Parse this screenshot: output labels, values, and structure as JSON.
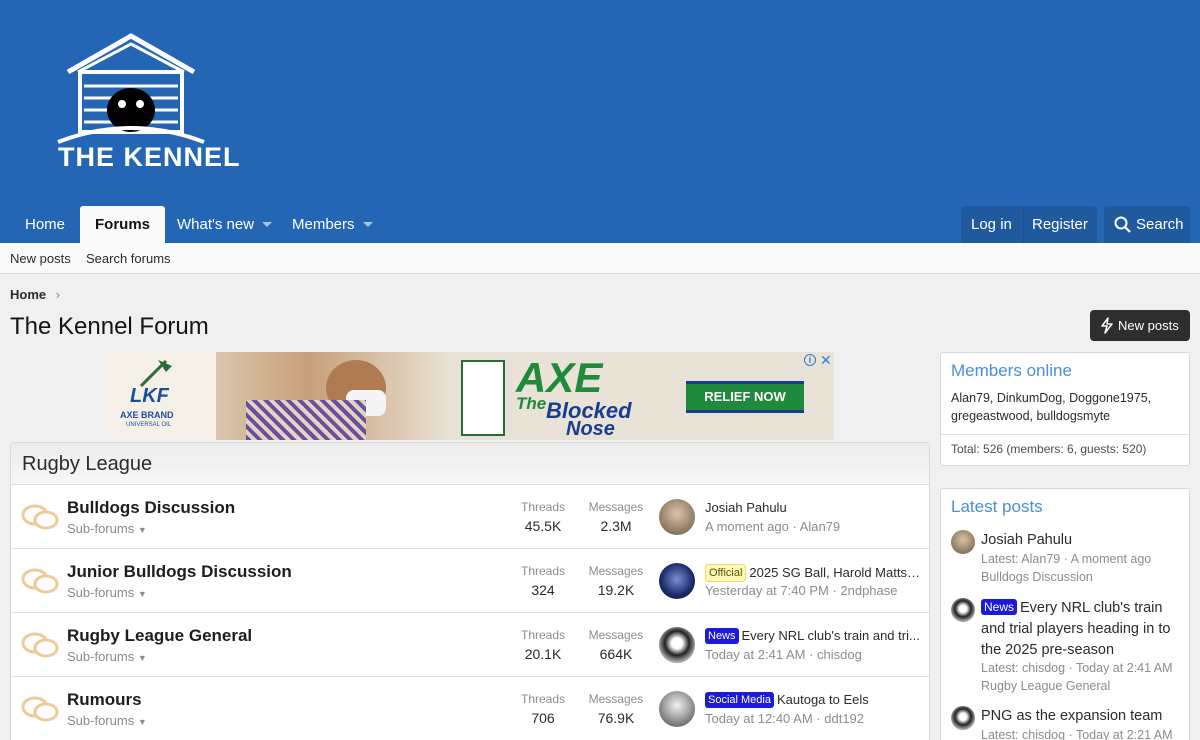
{
  "brand": {
    "name": "THE KENNEL"
  },
  "nav": {
    "tabs": [
      {
        "label": "Home"
      },
      {
        "label": "Forums"
      },
      {
        "label": "What's new"
      },
      {
        "label": "Members"
      }
    ],
    "login_label": "Log in",
    "register_label": "Register",
    "search_label": "Search"
  },
  "subnav": {
    "new_posts": "New posts",
    "search_forums": "Search forums"
  },
  "breadcrumb": {
    "home": "Home"
  },
  "page": {
    "title": "The Kennel Forum",
    "new_posts_button": "New posts"
  },
  "ad": {
    "brand_letters": "LKF",
    "brand_line1": "AXE BRAND",
    "brand_line2": "UNIVERSAL OIL",
    "headline_axe": "AXE",
    "headline_the": "The",
    "headline_blocked": "Blocked",
    "headline_nose": "Nose",
    "cta": "RELIEF NOW"
  },
  "category": {
    "title": "Rugby League",
    "threads_label": "Threads",
    "messages_label": "Messages",
    "subforums_label": "Sub-forums",
    "nodes": [
      {
        "title": "Bulldogs Discussion",
        "threads": "45.5K",
        "messages": "2.3M",
        "last_prefix": "",
        "last_title": "Josiah Pahulu",
        "last_time": "A moment ago",
        "last_user": "Alan79"
      },
      {
        "title": "Junior Bulldogs Discussion",
        "threads": "324",
        "messages": "19.2K",
        "last_prefix": "Official",
        "last_title": "2025 SG Ball, Harold Matts ...",
        "last_time": "Yesterday at 7:40 PM",
        "last_user": "2ndphase"
      },
      {
        "title": "Rugby League General",
        "threads": "20.1K",
        "messages": "664K",
        "last_prefix": "News",
        "last_title": "Every NRL club's train and tri...",
        "last_time": "Today at 2:41 AM",
        "last_user": "chisdog"
      },
      {
        "title": "Rumours",
        "threads": "706",
        "messages": "76.9K",
        "last_prefix": "Social Media",
        "last_title": "Kautoga to Eels",
        "last_time": "Today at 12:40 AM",
        "last_user": "ddt192"
      }
    ]
  },
  "members_online": {
    "title": "Members online",
    "list": "Alan79, DinkumDog, Doggone1975, gregeastwood, bulldogsmyte",
    "total": "Total: 526 (members: 6, guests: 520)"
  },
  "latest_posts": {
    "title": "Latest posts",
    "items": [
      {
        "prefix": "",
        "title": "Josiah Pahulu",
        "meta": "Latest: Alan79 · A moment ago",
        "forum": "Bulldogs Discussion"
      },
      {
        "prefix": "News",
        "title": "Every NRL club's train and trial players heading in to the 2025 pre-season",
        "meta": "Latest: chisdog · Today at 2:41 AM",
        "forum": "Rugby League General"
      },
      {
        "prefix": "",
        "title": "PNG as the expansion team",
        "meta": "Latest: chisdog · Today at 2:21 AM",
        "forum": ""
      }
    ]
  },
  "colors": {
    "header_bg": "#2466b3",
    "accent_link": "#4b8fd4",
    "news_label": "#1a1ad8"
  }
}
